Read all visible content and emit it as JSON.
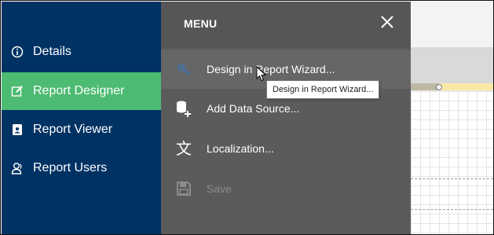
{
  "nav": {
    "items": [
      {
        "label": "Details",
        "icon": "info-icon",
        "active": false
      },
      {
        "label": "Report Designer",
        "icon": "edit-icon",
        "active": true
      },
      {
        "label": "Report Viewer",
        "icon": "report-viewer-icon",
        "active": false
      },
      {
        "label": "Report Users",
        "icon": "users-icon",
        "active": false
      }
    ]
  },
  "menu": {
    "title": "MENU",
    "close_icon": "close-icon",
    "items": [
      {
        "label": "Design in Report Wizard...",
        "icon": "wand-icon",
        "state": "hover"
      },
      {
        "label": "Add Data Source...",
        "icon": "add-database-icon",
        "state": "normal"
      },
      {
        "label": "Localization...",
        "icon": "localization-icon",
        "state": "normal"
      },
      {
        "label": "Save",
        "icon": "save-icon",
        "state": "disabled"
      }
    ]
  },
  "tooltip": {
    "text": "Design in Report Wizard..."
  },
  "colors": {
    "nav_bg": "#003264",
    "nav_active": "#4dbb72",
    "menu_bg": "#5b5b5b",
    "wand_blue": "#3d74b8"
  }
}
